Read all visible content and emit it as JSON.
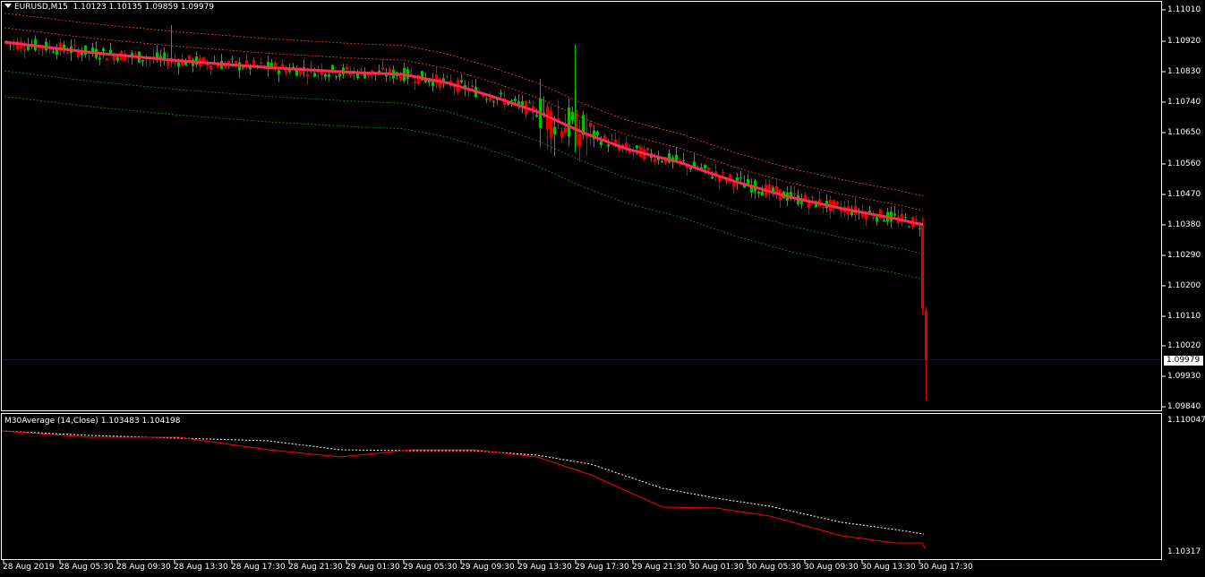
{
  "chart_header": {
    "symbol_timeframe": "EURUSD,M15",
    "ohlc": "1.10123 1.10135 1.09859 1.09979"
  },
  "price_axis": [
    "1.11010",
    "1.10920",
    "1.10830",
    "1.10740",
    "1.10650",
    "1.10560",
    "1.10470",
    "1.10380",
    "1.10290",
    "1.10200",
    "1.10110",
    "1.10020",
    "1.09930",
    "1.09840"
  ],
  "current_price": "1.09979",
  "indicator": {
    "title": "M30Average (14,Close) 1.103483 1.104198",
    "axis_top": "1.110047",
    "axis_bottom": "1.10317"
  },
  "time_axis": [
    "28 Aug 2019",
    "28 Aug 05:30",
    "28 Aug 09:30",
    "28 Aug 13:30",
    "28 Aug 17:30",
    "28 Aug 21:30",
    "29 Aug 01:30",
    "29 Aug 05:30",
    "29 Aug 09:30",
    "29 Aug 13:30",
    "29 Aug 17:30",
    "29 Aug 21:30",
    "30 Aug 01:30",
    "30 Aug 05:30",
    "30 Aug 09:30",
    "30 Aug 13:30",
    "30 Aug 17:30"
  ],
  "colors": {
    "background": "#000000",
    "bull_candle": "#00c000",
    "bear_candle": "#e00000",
    "ma_line": "#ff2a55",
    "upper_band": "#ff4040",
    "lower_band": "#00a000",
    "current_price_line": "#1010a0",
    "indicator_line": "#ff0000",
    "indicator_signal": "#ffffff"
  }
}
